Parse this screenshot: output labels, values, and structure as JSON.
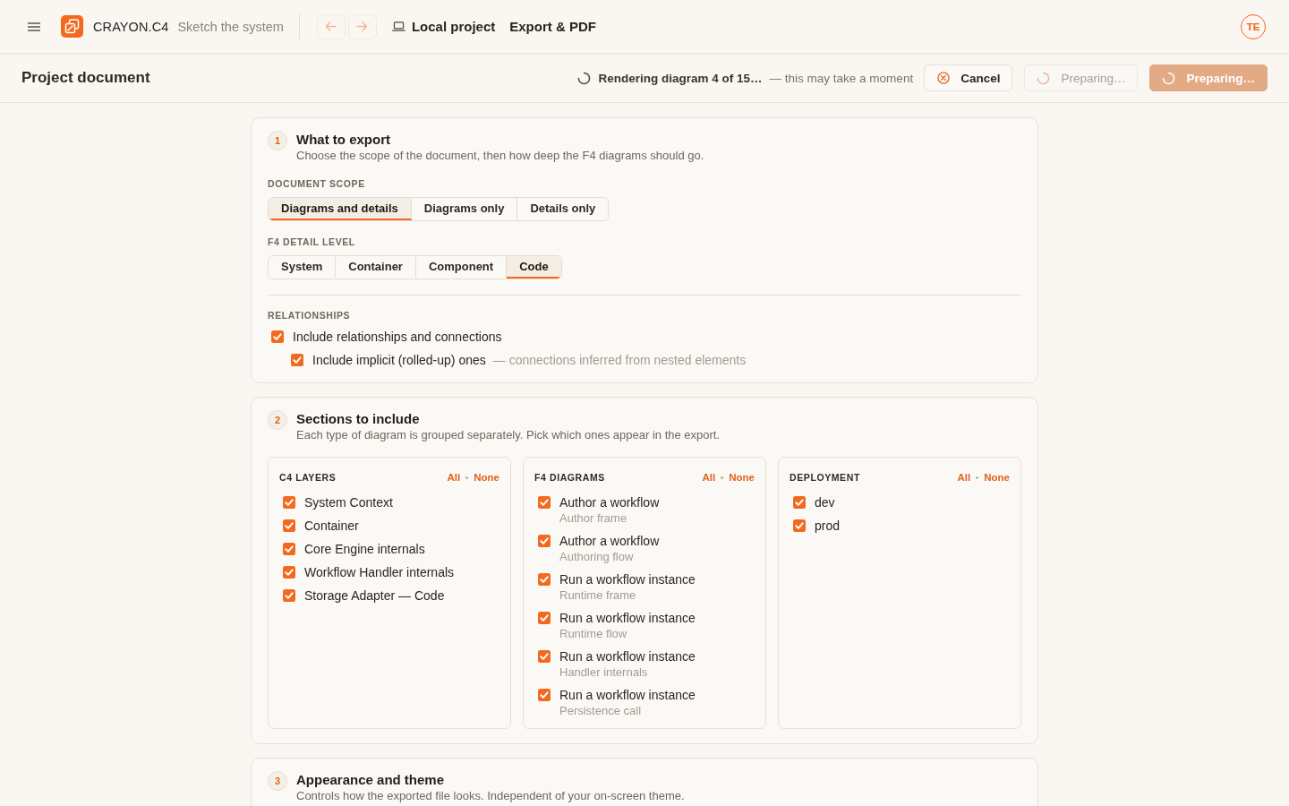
{
  "app_bar": {
    "brand": "CRAYON.C4",
    "tagline": "Sketch the system",
    "history": [
      {
        "kind": "back",
        "disabled": true
      },
      {
        "kind": "forward",
        "disabled": true
      }
    ],
    "nav": [
      {
        "kind": "project",
        "label": "Local project"
      },
      {
        "kind": "page",
        "label": "Export & PDF"
      }
    ],
    "user": {
      "initials": "TE"
    }
  },
  "toolbar": {
    "title": "Project document",
    "status": {
      "busy": true,
      "text": "Rendering diagram 4 of 15…",
      "note": "— this may take a moment"
    },
    "buttons": [
      {
        "kind": "cancel",
        "label": "Cancel",
        "disabled": false,
        "busy": false
      },
      {
        "kind": "secondary",
        "label": "Preparing…",
        "disabled": true,
        "busy": true
      },
      {
        "kind": "primary",
        "label": "Preparing…",
        "disabled": true,
        "busy": true
      }
    ]
  },
  "sections": [
    {
      "number": "1",
      "title": "What to export",
      "description": "Choose the scope of the document, then how deep the F4 diagrams should go.",
      "blocks": [
        {
          "kind": "segmented",
          "label": "DOCUMENT SCOPE",
          "options": [
            {
              "label": "Diagrams and details",
              "selected": true
            },
            {
              "label": "Diagrams only",
              "selected": false
            },
            {
              "label": "Details only",
              "selected": false
            }
          ]
        },
        {
          "kind": "segmented",
          "label": "F4 DETAIL LEVEL",
          "options": [
            {
              "label": "System",
              "selected": false
            },
            {
              "label": "Container",
              "selected": false
            },
            {
              "label": "Component",
              "selected": false
            },
            {
              "label": "Code",
              "selected": true
            }
          ]
        },
        {
          "kind": "checklist",
          "label": "RELATIONSHIPS",
          "items": [
            {
              "label": "Include relationships and connections",
              "checked": true,
              "children": [
                {
                  "label": "Include implicit (rolled-up) ones",
                  "hint": "— connections inferred from nested elements",
                  "checked": true
                }
              ]
            }
          ]
        }
      ]
    },
    {
      "number": "2",
      "title": "Sections to include",
      "description": "Each type of diagram is grouped separately. Pick which ones appear in the export.",
      "blocks": [
        {
          "kind": "columns",
          "groups": [
            {
              "title": "C4 LAYERS",
              "all": "All",
              "none": "None",
              "items": [
                {
                  "label": "System Context",
                  "checked": true
                },
                {
                  "label": "Container",
                  "checked": true
                },
                {
                  "label": "Core Engine internals",
                  "checked": true
                },
                {
                  "label": "Workflow Handler internals",
                  "checked": true
                },
                {
                  "label": "Storage Adapter — Code",
                  "checked": true
                }
              ]
            },
            {
              "title": "F4 DIAGRAMS",
              "all": "All",
              "none": "None",
              "items": [
                {
                  "label": "Author a workflow",
                  "detail": "Author frame",
                  "checked": true
                },
                {
                  "label": "Author a workflow",
                  "detail": "Authoring flow",
                  "checked": true
                },
                {
                  "label": "Run a workflow instance",
                  "detail": "Runtime frame",
                  "checked": true
                },
                {
                  "label": "Run a workflow instance",
                  "detail": "Runtime flow",
                  "checked": true
                },
                {
                  "label": "Run a workflow instance",
                  "detail": "Handler internals",
                  "checked": true
                },
                {
                  "label": "Run a workflow instance",
                  "detail": "Persistence call",
                  "checked": true
                }
              ]
            },
            {
              "title": "DEPLOYMENT",
              "all": "All",
              "none": "None",
              "items": [
                {
                  "label": "dev",
                  "checked": true
                },
                {
                  "label": "prod",
                  "checked": true
                }
              ]
            }
          ]
        }
      ]
    },
    {
      "number": "3",
      "title": "Appearance and theme",
      "description": "Controls how the exported file looks. Independent of your on-screen theme."
    }
  ]
}
